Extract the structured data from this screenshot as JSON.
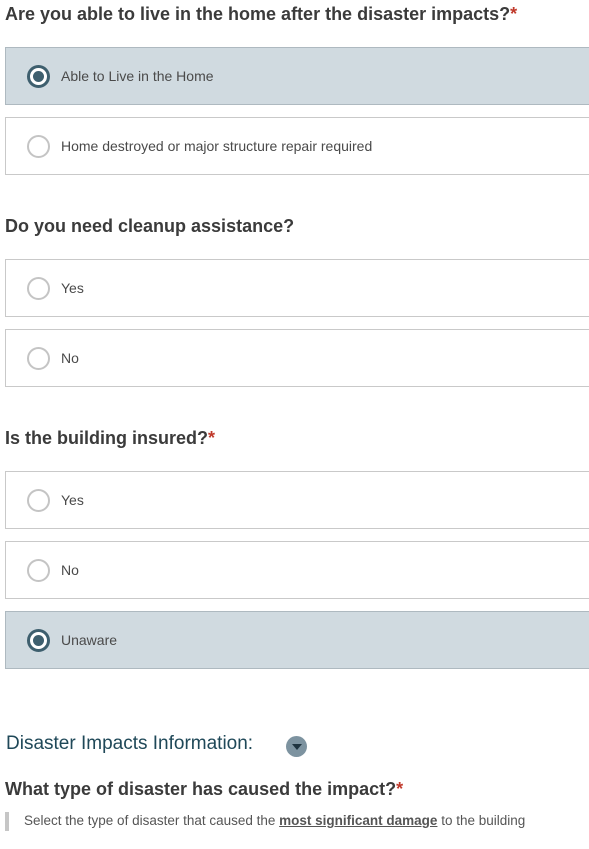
{
  "questions": [
    {
      "text": "Are you able to live in the home after the disaster impacts?",
      "required_mark": "*",
      "options": [
        {
          "label": "Able to Live in the Home",
          "selected": true
        },
        {
          "label": "Home destroyed or major structure repair required",
          "selected": false
        }
      ]
    },
    {
      "text": "Do you need cleanup assistance?",
      "required_mark": "",
      "options": [
        {
          "label": "Yes",
          "selected": false
        },
        {
          "label": "No",
          "selected": false
        }
      ]
    },
    {
      "text": "Is the building insured?",
      "required_mark": "*",
      "options": [
        {
          "label": "Yes",
          "selected": false
        },
        {
          "label": "No",
          "selected": false
        },
        {
          "label": "Unaware",
          "selected": true
        }
      ]
    }
  ],
  "section": {
    "title": "Disaster Impacts Information:",
    "toggle_icon": "chevron-down-icon"
  },
  "disaster_question": {
    "text": "What type of disaster has caused the impact?",
    "required_mark": "*",
    "hint_before": "Select the type of disaster that caused the ",
    "hint_emphasis": "most significant damage",
    "hint_after": " to the building"
  },
  "colors": {
    "selected_background": "#d0dae0",
    "radio_selected": "#3e5f6e",
    "required": "#c0392b",
    "section_title": "#1f4858"
  }
}
